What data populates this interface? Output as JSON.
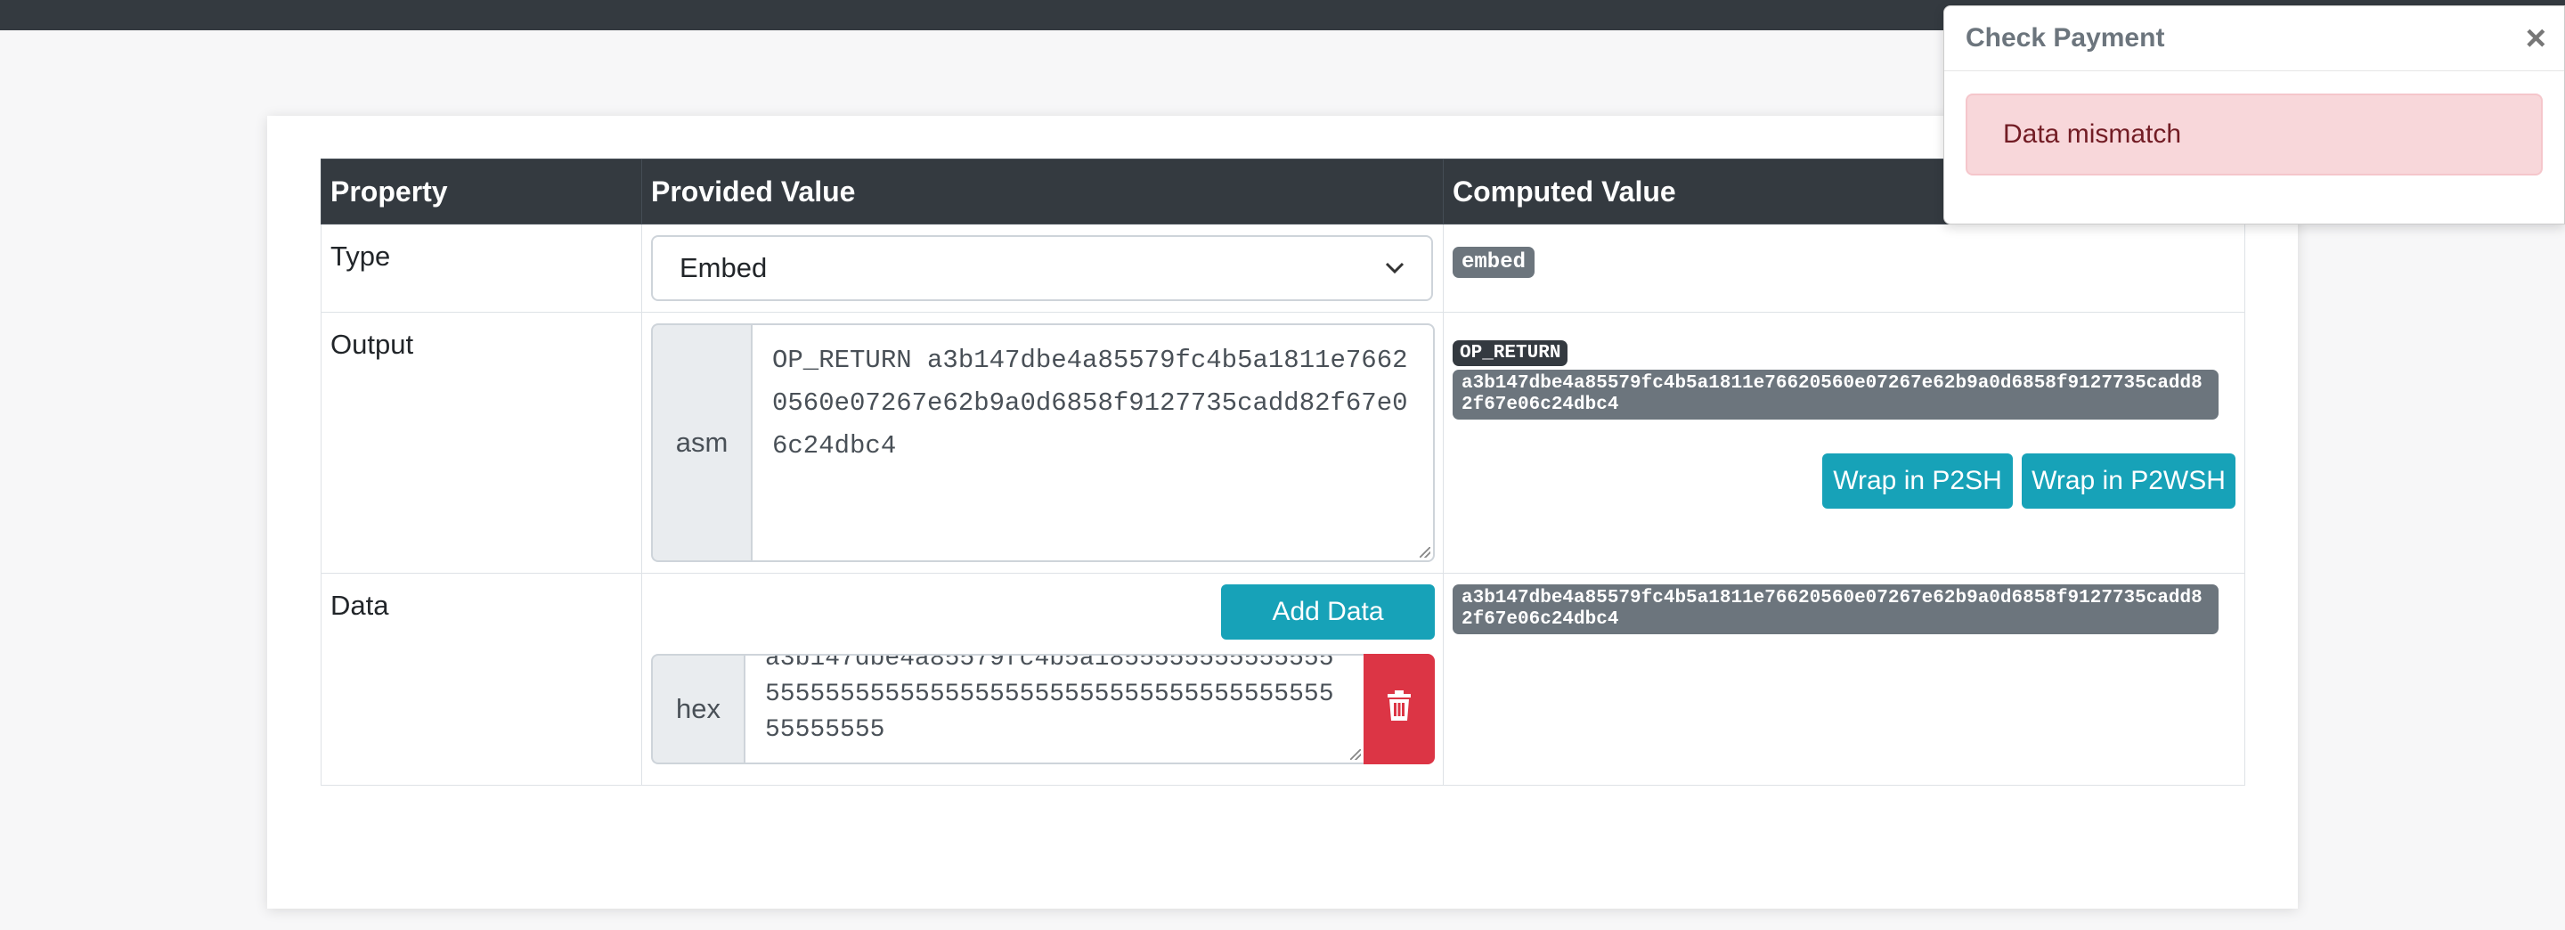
{
  "table": {
    "headers": [
      "Property",
      "Provided Value",
      "Computed Value"
    ],
    "rows": {
      "type": {
        "label": "Type",
        "select_value": "Embed",
        "computed_badge": "embed"
      },
      "output": {
        "label": "Output",
        "addon": "asm",
        "textarea_value": "OP_RETURN a3b147dbe4a85579fc4b5a1811e76620560e07267e62b9a0d6858f9127735cadd82f67e06c24dbc4",
        "computed_opcode": "OP_RETURN",
        "computed_hex": "a3b147dbe4a85579fc4b5a1811e76620560e07267e62b9a0d6858f9127735cadd82f67e06c24dbc4",
        "wrap_p2sh": "Wrap in P2SH",
        "wrap_p2wsh": "Wrap in P2WSH"
      },
      "data": {
        "label": "Data",
        "add_button": "Add Data",
        "addon": "hex",
        "textarea_value": "a3b147dbe4a85579fc4b5a18555555555555555555555555555555555555555555555555555555555555",
        "computed_hex": "a3b147dbe4a85579fc4b5a1811e76620560e07267e62b9a0d6858f9127735cadd82f67e06c24dbc4"
      }
    }
  },
  "popover": {
    "title": "Check Payment",
    "close_icon": "×",
    "alert_text": "Data mismatch"
  },
  "colors": {
    "header_bg": "#343a40",
    "info": "#17a2b8",
    "danger": "#dc3545",
    "alert_bg": "#f8d7da",
    "badge_secondary": "#6c757d"
  }
}
